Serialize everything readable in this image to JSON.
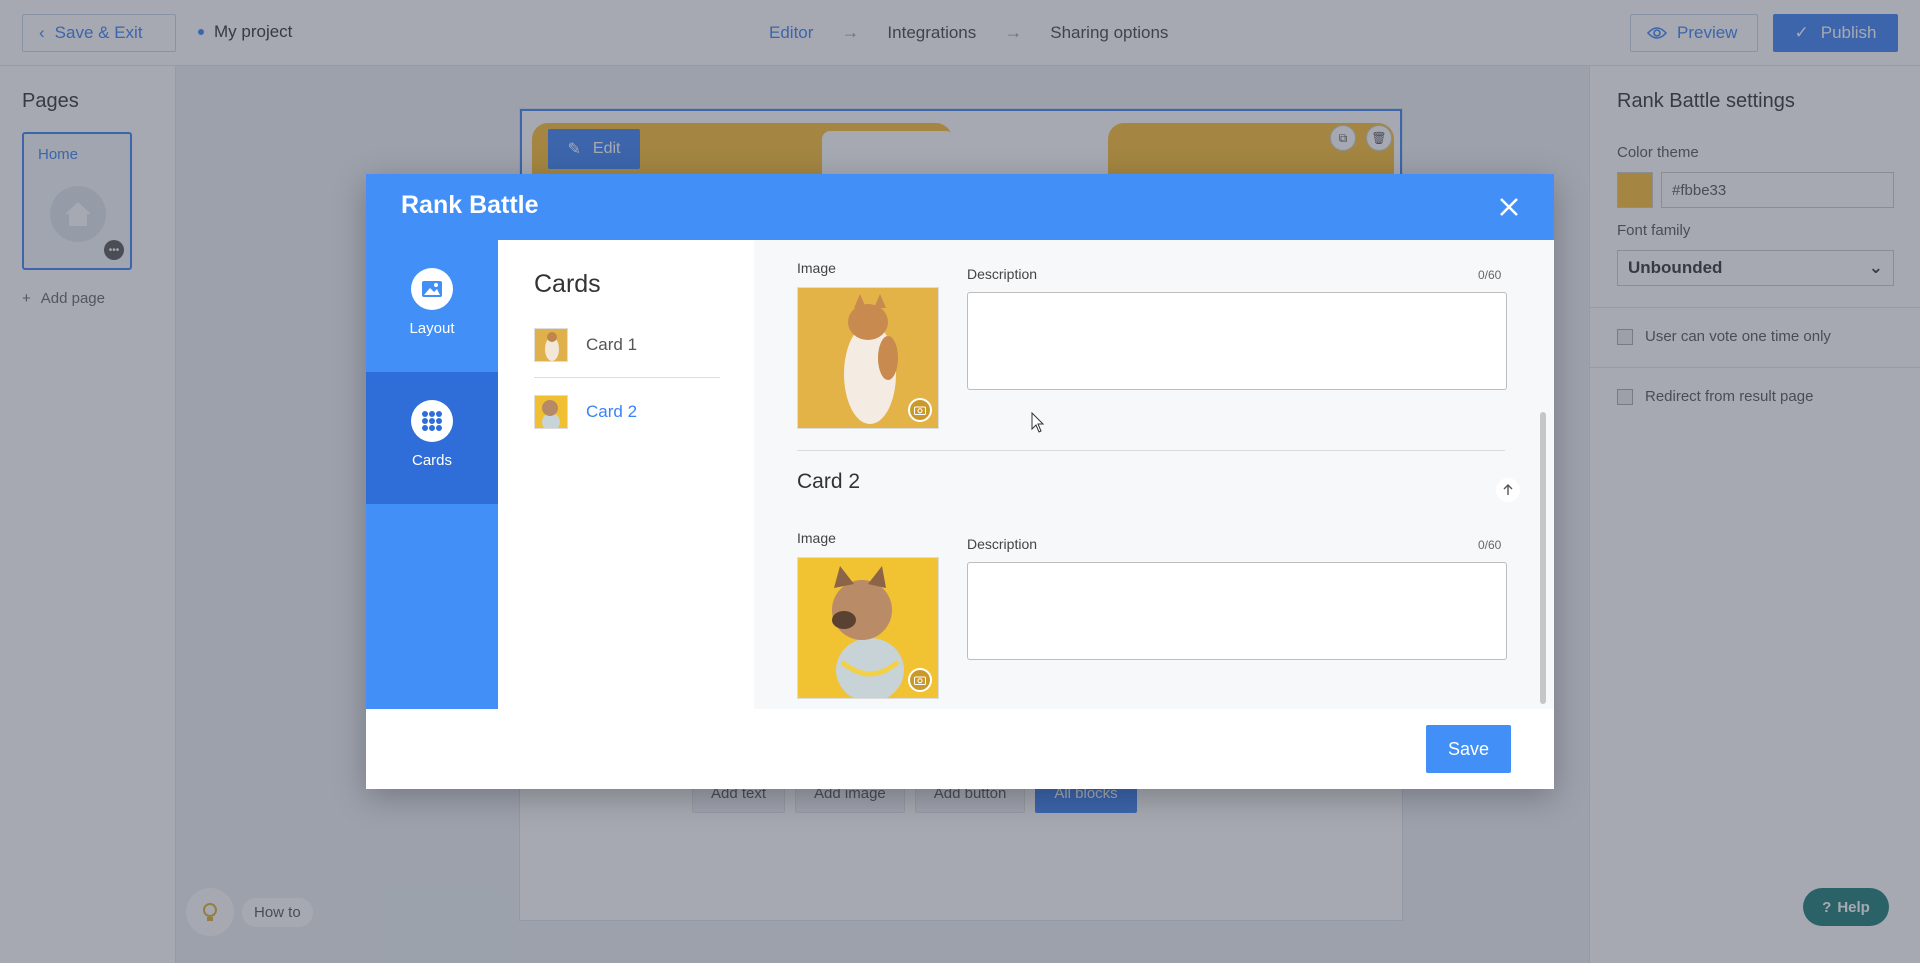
{
  "topbar": {
    "save_exit": "Save & Exit",
    "project_name": "My project",
    "steps": [
      "Editor",
      "Integrations",
      "Sharing options"
    ],
    "preview": "Preview",
    "publish": "Publish"
  },
  "left_panel": {
    "title": "Pages",
    "page_label": "Home",
    "add_page": "Add page"
  },
  "canvas": {
    "edit": "Edit",
    "add_blocks": [
      "Add text",
      "Add image",
      "Add button",
      "All blocks"
    ]
  },
  "right_panel": {
    "title": "Rank Battle settings",
    "color_theme_label": "Color theme",
    "color_value": "#fbbe33",
    "font_family_label": "Font family",
    "font_value": "Unbounded",
    "vote_once": "User can vote one time only",
    "redirect": "Redirect from result page"
  },
  "howto": "How to",
  "help": "Help",
  "modal": {
    "title": "Rank Battle",
    "nav": [
      {
        "label": "Layout",
        "icon": "image-icon"
      },
      {
        "label": "Cards",
        "icon": "grid-icon"
      }
    ],
    "cards_title": "Cards",
    "cards": [
      "Card 1",
      "Card 2"
    ],
    "card1": {
      "image_label": "Image",
      "description_label": "Description",
      "counter": "0/60"
    },
    "card2": {
      "title": "Card 2",
      "image_label": "Image",
      "description_label": "Description",
      "counter": "0/60"
    },
    "save": "Save"
  },
  "colors": {
    "accent": "#418ff7",
    "accent_dark": "#2f6ed8",
    "theme": "#fbbe33",
    "help": "#1c7d78"
  }
}
